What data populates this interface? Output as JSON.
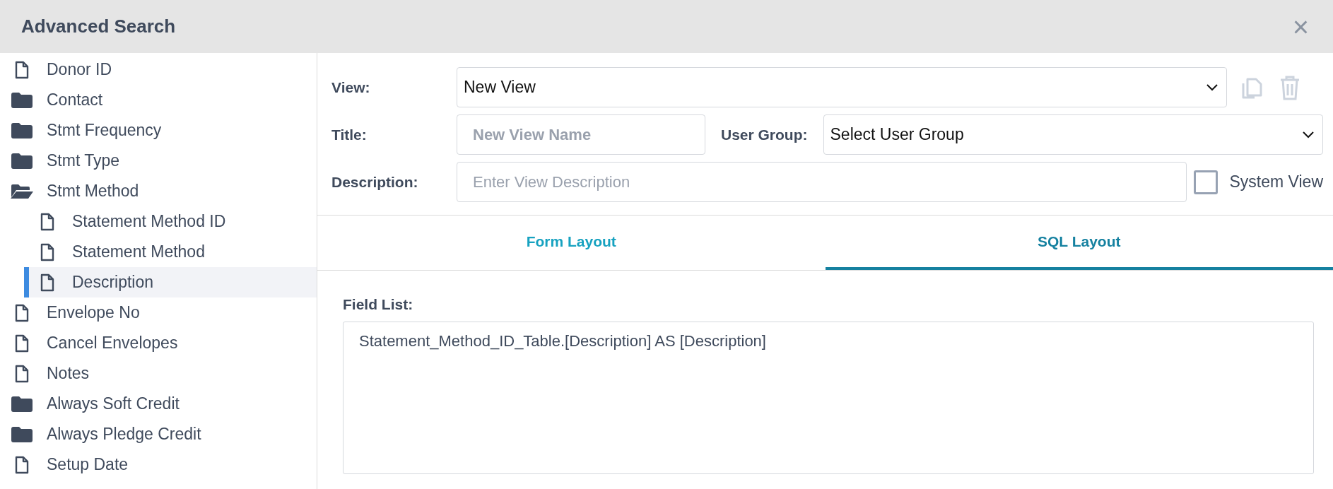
{
  "window": {
    "title": "Advanced Search",
    "close": "×"
  },
  "tree": [
    {
      "label": "Donor ID",
      "kind": "file",
      "selected": false
    },
    {
      "label": "Contact",
      "kind": "folder",
      "expanded": false,
      "selected": false
    },
    {
      "label": "Stmt Frequency",
      "kind": "folder",
      "expanded": false,
      "selected": false
    },
    {
      "label": "Stmt Type",
      "kind": "folder",
      "expanded": false,
      "selected": false
    },
    {
      "label": "Stmt Method",
      "kind": "folder",
      "expanded": true,
      "selected": false,
      "children": [
        {
          "label": "Statement Method ID",
          "kind": "file",
          "selected": false
        },
        {
          "label": "Statement Method",
          "kind": "file",
          "selected": false
        },
        {
          "label": "Description",
          "kind": "file",
          "selected": true
        }
      ]
    },
    {
      "label": "Envelope No",
      "kind": "file",
      "selected": false
    },
    {
      "label": "Cancel Envelopes",
      "kind": "file",
      "selected": false
    },
    {
      "label": "Notes",
      "kind": "file",
      "selected": false
    },
    {
      "label": "Always Soft Credit",
      "kind": "folder",
      "expanded": false,
      "selected": false
    },
    {
      "label": "Always Pledge Credit",
      "kind": "folder",
      "expanded": false,
      "selected": false
    },
    {
      "label": "Setup Date",
      "kind": "file",
      "selected": false
    }
  ],
  "form": {
    "view_label": "View:",
    "view_value": "New View",
    "title_label": "Title:",
    "title_placeholder": "New View Name",
    "user_group_label": "User Group:",
    "user_group_value": "Select User Group",
    "description_label": "Description:",
    "description_placeholder": "Enter View Description",
    "system_view": {
      "label": "System View",
      "checked": false
    }
  },
  "tabs": [
    {
      "label": "Form Layout",
      "selected": false
    },
    {
      "label": "SQL Layout",
      "selected": true
    }
  ],
  "field_list": {
    "label": "Field List:",
    "value": "Statement_Method_ID_Table.[Description] AS [Description]"
  }
}
